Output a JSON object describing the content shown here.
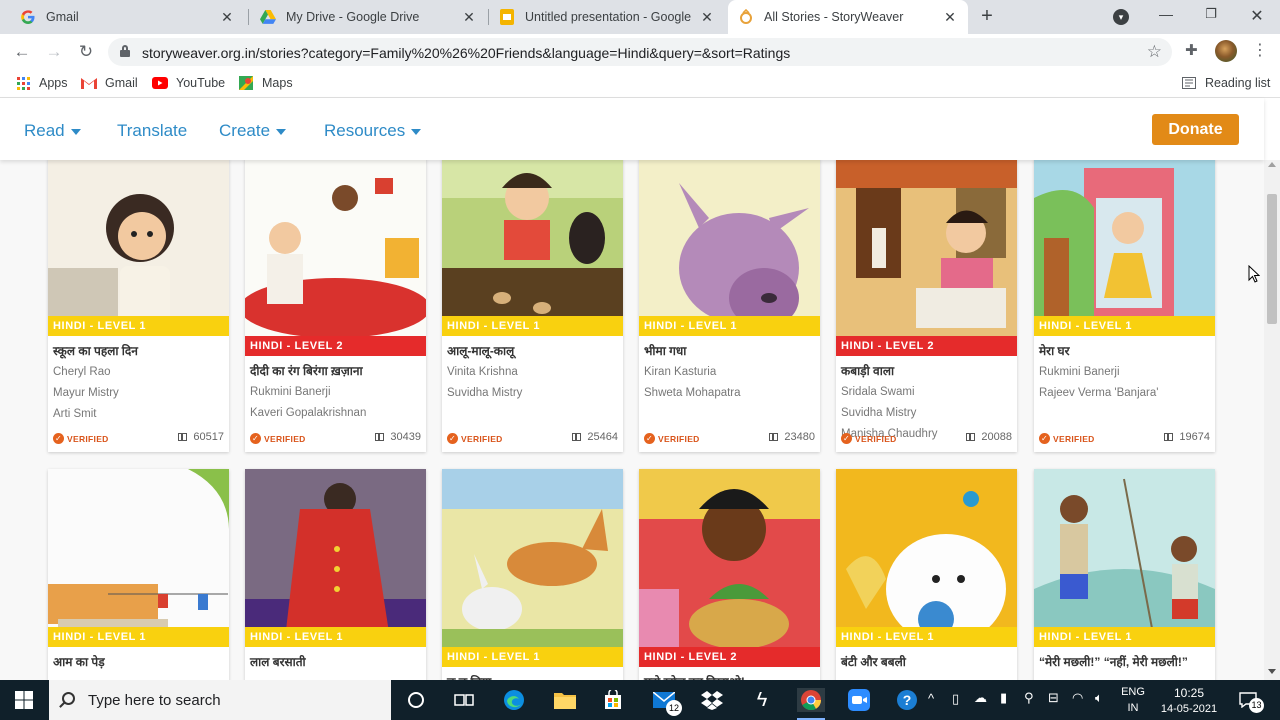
{
  "tabs": [
    {
      "title": "Gmail",
      "icon": "google-g-icon"
    },
    {
      "title": "My Drive - Google Drive",
      "icon": "google-drive-icon"
    },
    {
      "title": "Untitled presentation - Google Sl",
      "icon": "google-slides-icon"
    },
    {
      "title": "All Stories - StoryWeaver",
      "icon": "storyweaver-icon",
      "active": true
    }
  ],
  "address": {
    "url": "storyweaver.org.in/stories?category=Family%20%26%20Friends&language=Hindi&query=&sort=Ratings"
  },
  "bookmarks": [
    {
      "label": "Apps",
      "icon": "apps-grid-icon"
    },
    {
      "label": "Gmail",
      "icon": "gmail-icon"
    },
    {
      "label": "YouTube",
      "icon": "youtube-icon"
    },
    {
      "label": "Maps",
      "icon": "maps-icon"
    }
  ],
  "reading_list": "Reading list",
  "site_nav": {
    "read": "Read",
    "translate": "Translate",
    "create": "Create",
    "resources": "Resources",
    "donate": "Donate"
  },
  "colors": {
    "link_blue": "#2e8bc7",
    "donate_orange": "#e28a17",
    "level_yellow": "#f9d10f",
    "level_red": "#e52b2b",
    "verified_orange": "#d9541a"
  },
  "verified_label": "VERIFIED",
  "stories_row1": [
    {
      "level": "HINDI - LEVEL 1",
      "level_color": "yellow",
      "title": "स्कूल का पहला दिन",
      "authors": [
        "Cheryl Rao",
        "Mayur Mistry",
        "Arti Smit"
      ],
      "reads": "60517"
    },
    {
      "level": "HINDI - LEVEL 2",
      "level_color": "red",
      "title": "दीदी का रंग बिरंगा ख़ज़ाना",
      "authors": [
        "Rukmini Banerji",
        "Kaveri Gopalakrishnan"
      ],
      "reads": "30439"
    },
    {
      "level": "HINDI - LEVEL 1",
      "level_color": "yellow",
      "title": "आलू-मालू-कालू",
      "authors": [
        "Vinita Krishna",
        "Suvidha Mistry"
      ],
      "reads": "25464"
    },
    {
      "level": "HINDI - LEVEL 1",
      "level_color": "yellow",
      "title": "भीमा गधा",
      "authors": [
        "Kiran Kasturia",
        "Shweta Mohapatra"
      ],
      "reads": "23480"
    },
    {
      "level": "HINDI - LEVEL 2",
      "level_color": "red",
      "title": "कबाड़ी वाला",
      "authors": [
        "Sridala Swami",
        "Suvidha Mistry",
        "Manisha Chaudhry"
      ],
      "reads": "20088"
    },
    {
      "level": "HINDI - LEVEL 1",
      "level_color": "yellow",
      "title": "मेरा घर",
      "authors": [
        "Rukmini Banerji",
        "Rajeev Verma 'Banjara'"
      ],
      "reads": "19674"
    }
  ],
  "stories_row2": [
    {
      "level": "HINDI - LEVEL 1",
      "level_color": "yellow",
      "title": "आम का पेड़"
    },
    {
      "level": "HINDI - LEVEL 1",
      "level_color": "yellow",
      "title": "लाल बरसाती"
    },
    {
      "level": "HINDI - LEVEL 1",
      "level_color": "yellow",
      "title": "छू छू चिया"
    },
    {
      "level": "HINDI - LEVEL 2",
      "level_color": "red",
      "title": "मुझे खोज कर दिखाओ!"
    },
    {
      "level": "HINDI - LEVEL 1",
      "level_color": "yellow",
      "title": "बंटी और बबली"
    },
    {
      "level": "HINDI - LEVEL 1",
      "level_color": "yellow",
      "title": "“मेरी मछली!” “नहीं, मेरी मछली!”"
    }
  ],
  "taskbar": {
    "search_placeholder": "Type here to search",
    "mail_badge": "12",
    "lang": "ENG",
    "region": "IN",
    "time": "10:25",
    "date": "14-05-2021",
    "notifications": "13"
  }
}
